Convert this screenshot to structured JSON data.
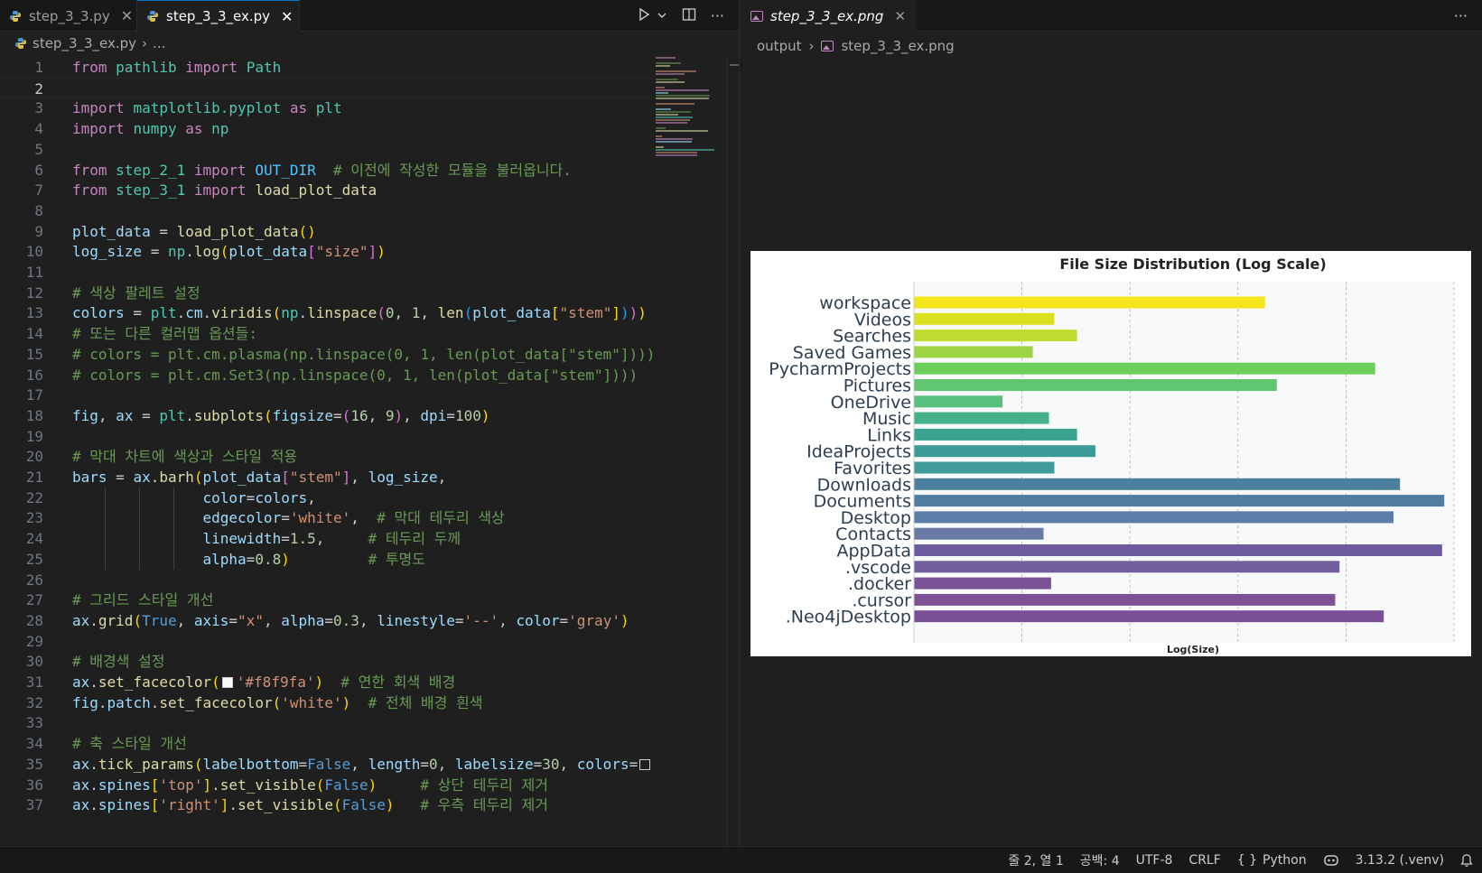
{
  "editor": {
    "tabs": [
      {
        "label": "step_3_3.py",
        "active": false
      },
      {
        "label": "step_3_3_ex.py",
        "active": true
      }
    ],
    "breadcrumb": {
      "file": "step_3_3_ex.py",
      "trail": "..."
    },
    "current_line": 2,
    "lines": [
      {
        "n": "1",
        "toks": [
          [
            "kw",
            "from"
          ],
          [
            "t",
            " "
          ],
          [
            "cls",
            "pathlib"
          ],
          [
            "t",
            " "
          ],
          [
            "kw",
            "import"
          ],
          [
            "t",
            " "
          ],
          [
            "cls",
            "Path"
          ]
        ]
      },
      {
        "n": "2",
        "toks": []
      },
      {
        "n": "3",
        "toks": [
          [
            "kw",
            "import"
          ],
          [
            "t",
            " "
          ],
          [
            "cls",
            "matplotlib.pyplot"
          ],
          [
            "t",
            " "
          ],
          [
            "kw",
            "as"
          ],
          [
            "t",
            " "
          ],
          [
            "cls",
            "plt"
          ]
        ]
      },
      {
        "n": "4",
        "toks": [
          [
            "kw",
            "import"
          ],
          [
            "t",
            " "
          ],
          [
            "cls",
            "numpy"
          ],
          [
            "t",
            " "
          ],
          [
            "kw",
            "as"
          ],
          [
            "t",
            " "
          ],
          [
            "cls",
            "np"
          ]
        ]
      },
      {
        "n": "5",
        "toks": []
      },
      {
        "n": "6",
        "toks": [
          [
            "kw",
            "from"
          ],
          [
            "t",
            " "
          ],
          [
            "cls",
            "step_2_1"
          ],
          [
            "t",
            " "
          ],
          [
            "kw",
            "import"
          ],
          [
            "t",
            " "
          ],
          [
            "const",
            "OUT_DIR"
          ],
          [
            "t",
            "  "
          ],
          [
            "cm",
            "# 이전에 작성한 모듈을 불러옵니다."
          ]
        ]
      },
      {
        "n": "7",
        "toks": [
          [
            "kw",
            "from"
          ],
          [
            "t",
            " "
          ],
          [
            "cls",
            "step_3_1"
          ],
          [
            "t",
            " "
          ],
          [
            "kw",
            "import"
          ],
          [
            "t",
            " "
          ],
          [
            "fn",
            "load_plot_data"
          ]
        ]
      },
      {
        "n": "8",
        "toks": []
      },
      {
        "n": "9",
        "toks": [
          [
            "var",
            "plot_data"
          ],
          [
            "t",
            " = "
          ],
          [
            "fn",
            "load_plot_data"
          ],
          [
            "br1",
            "()"
          ]
        ]
      },
      {
        "n": "10",
        "toks": [
          [
            "var",
            "log_size"
          ],
          [
            "t",
            " = "
          ],
          [
            "cls",
            "np"
          ],
          [
            "t",
            "."
          ],
          [
            "fn",
            "log"
          ],
          [
            "br1",
            "("
          ],
          [
            "var",
            "plot_data"
          ],
          [
            "br2",
            "["
          ],
          [
            "str",
            "\"size\""
          ],
          [
            "br2",
            "]"
          ],
          [
            "br1",
            ")"
          ]
        ]
      },
      {
        "n": "11",
        "toks": []
      },
      {
        "n": "12",
        "toks": [
          [
            "cm",
            "# 색상 팔레트 설정"
          ]
        ]
      },
      {
        "n": "13",
        "toks": [
          [
            "var",
            "colors"
          ],
          [
            "t",
            " = "
          ],
          [
            "cls",
            "plt"
          ],
          [
            "t",
            "."
          ],
          [
            "var",
            "cm"
          ],
          [
            "t",
            "."
          ],
          [
            "fn",
            "viridis"
          ],
          [
            "br1",
            "("
          ],
          [
            "cls",
            "np"
          ],
          [
            "t",
            "."
          ],
          [
            "fn",
            "linspace"
          ],
          [
            "br2",
            "("
          ],
          [
            "num",
            "0"
          ],
          [
            "t",
            ", "
          ],
          [
            "num",
            "1"
          ],
          [
            "t",
            ", "
          ],
          [
            "fn",
            "len"
          ],
          [
            "br3",
            "("
          ],
          [
            "var",
            "plot_data"
          ],
          [
            "br1",
            "["
          ],
          [
            "str",
            "\"stem\""
          ],
          [
            "br1",
            "]"
          ],
          [
            "br3",
            ")"
          ],
          [
            "br2",
            ")"
          ],
          [
            "br1",
            ")"
          ]
        ]
      },
      {
        "n": "14",
        "toks": [
          [
            "cm",
            "# 또는 다른 컬러맵 옵션들:"
          ]
        ]
      },
      {
        "n": "15",
        "toks": [
          [
            "cm",
            "# colors = plt.cm.plasma(np.linspace(0, 1, len(plot_data[\"stem\"])))"
          ]
        ]
      },
      {
        "n": "16",
        "toks": [
          [
            "cm",
            "# colors = plt.cm.Set3(np.linspace(0, 1, len(plot_data[\"stem\"])))"
          ]
        ]
      },
      {
        "n": "17",
        "toks": []
      },
      {
        "n": "18",
        "toks": [
          [
            "var",
            "fig"
          ],
          [
            "t",
            ", "
          ],
          [
            "var",
            "ax"
          ],
          [
            "t",
            " = "
          ],
          [
            "cls",
            "plt"
          ],
          [
            "t",
            "."
          ],
          [
            "fn",
            "subplots"
          ],
          [
            "br1",
            "("
          ],
          [
            "var",
            "figsize"
          ],
          [
            "t",
            "="
          ],
          [
            "br2",
            "("
          ],
          [
            "num",
            "16"
          ],
          [
            "t",
            ", "
          ],
          [
            "num",
            "9"
          ],
          [
            "br2",
            ")"
          ],
          [
            "t",
            ", "
          ],
          [
            "var",
            "dpi"
          ],
          [
            "t",
            "="
          ],
          [
            "num",
            "100"
          ],
          [
            "br1",
            ")"
          ]
        ]
      },
      {
        "n": "19",
        "toks": []
      },
      {
        "n": "20",
        "toks": [
          [
            "cm",
            "# 막대 차트에 색상과 스타일 적용"
          ]
        ]
      },
      {
        "n": "21",
        "toks": [
          [
            "var",
            "bars"
          ],
          [
            "t",
            " = "
          ],
          [
            "var",
            "ax"
          ],
          [
            "t",
            "."
          ],
          [
            "fn",
            "barh"
          ],
          [
            "br1",
            "("
          ],
          [
            "var",
            "plot_data"
          ],
          [
            "br2",
            "["
          ],
          [
            "str",
            "\"stem\""
          ],
          [
            "br2",
            "]"
          ],
          [
            "t",
            ", "
          ],
          [
            "var",
            "log_size"
          ],
          [
            "t",
            ","
          ]
        ]
      },
      {
        "n": "22",
        "guides": true,
        "toks": [
          [
            "t",
            "               "
          ],
          [
            "var",
            "color"
          ],
          [
            "t",
            "="
          ],
          [
            "var",
            "colors"
          ],
          [
            "t",
            ","
          ]
        ]
      },
      {
        "n": "23",
        "guides": true,
        "toks": [
          [
            "t",
            "               "
          ],
          [
            "var",
            "edgecolor"
          ],
          [
            "t",
            "="
          ],
          [
            "str",
            "'white'"
          ],
          [
            "t",
            ",  "
          ],
          [
            "cm",
            "# 막대 테두리 색상"
          ]
        ]
      },
      {
        "n": "24",
        "guides": true,
        "toks": [
          [
            "t",
            "               "
          ],
          [
            "var",
            "linewidth"
          ],
          [
            "t",
            "="
          ],
          [
            "num",
            "1.5"
          ],
          [
            "t",
            ",     "
          ],
          [
            "cm",
            "# 테두리 두께"
          ]
        ]
      },
      {
        "n": "25",
        "guides": true,
        "toks": [
          [
            "t",
            "               "
          ],
          [
            "var",
            "alpha"
          ],
          [
            "t",
            "="
          ],
          [
            "num",
            "0.8"
          ],
          [
            "br1",
            ")"
          ],
          [
            "t",
            "         "
          ],
          [
            "cm",
            "# 투명도"
          ]
        ]
      },
      {
        "n": "26",
        "toks": []
      },
      {
        "n": "27",
        "toks": [
          [
            "cm",
            "# 그리드 스타일 개선"
          ]
        ]
      },
      {
        "n": "28",
        "toks": [
          [
            "var",
            "ax"
          ],
          [
            "t",
            "."
          ],
          [
            "fn",
            "grid"
          ],
          [
            "br1",
            "("
          ],
          [
            "bool",
            "True"
          ],
          [
            "t",
            ", "
          ],
          [
            "var",
            "axis"
          ],
          [
            "t",
            "="
          ],
          [
            "str",
            "\"x\""
          ],
          [
            "t",
            ", "
          ],
          [
            "var",
            "alpha"
          ],
          [
            "t",
            "="
          ],
          [
            "num",
            "0.3"
          ],
          [
            "t",
            ", "
          ],
          [
            "var",
            "linestyle"
          ],
          [
            "t",
            "="
          ],
          [
            "str",
            "'--'"
          ],
          [
            "t",
            ", "
          ],
          [
            "var",
            "color"
          ],
          [
            "t",
            "="
          ],
          [
            "str",
            "'gray'"
          ],
          [
            "br1",
            ")"
          ]
        ]
      },
      {
        "n": "29",
        "toks": []
      },
      {
        "n": "30",
        "toks": [
          [
            "cm",
            "# 배경색 설정"
          ]
        ]
      },
      {
        "n": "31",
        "toks": [
          [
            "var",
            "ax"
          ],
          [
            "t",
            "."
          ],
          [
            "fn",
            "set_facecolor"
          ],
          [
            "br1",
            "("
          ],
          [
            "swatch",
            "#f8f9fa"
          ],
          [
            "str",
            "'#f8f9fa'"
          ],
          [
            "br1",
            ")"
          ],
          [
            "t",
            "  "
          ],
          [
            "cm",
            "# 연한 회색 배경"
          ]
        ]
      },
      {
        "n": "32",
        "toks": [
          [
            "var",
            "fig"
          ],
          [
            "t",
            "."
          ],
          [
            "var",
            "patch"
          ],
          [
            "t",
            "."
          ],
          [
            "fn",
            "set_facecolor"
          ],
          [
            "br1",
            "("
          ],
          [
            "str",
            "'white'"
          ],
          [
            "br1",
            ")"
          ],
          [
            "t",
            "  "
          ],
          [
            "cm",
            "# 전체 배경 흰색"
          ]
        ]
      },
      {
        "n": "33",
        "toks": []
      },
      {
        "n": "34",
        "toks": [
          [
            "cm",
            "# 축 스타일 개선"
          ]
        ]
      },
      {
        "n": "35",
        "toks": [
          [
            "var",
            "ax"
          ],
          [
            "t",
            "."
          ],
          [
            "fn",
            "tick_params"
          ],
          [
            "br1",
            "("
          ],
          [
            "var",
            "labelbottom"
          ],
          [
            "t",
            "="
          ],
          [
            "bool",
            "False"
          ],
          [
            "t",
            ", "
          ],
          [
            "var",
            "length"
          ],
          [
            "t",
            "="
          ],
          [
            "num",
            "0"
          ],
          [
            "t",
            ", "
          ],
          [
            "var",
            "labelsize"
          ],
          [
            "t",
            "="
          ],
          [
            "num",
            "30"
          ],
          [
            "t",
            ", "
          ],
          [
            "var",
            "colors"
          ],
          [
            "t",
            "="
          ],
          [
            "swatch",
            "#cccccc"
          ]
        ]
      },
      {
        "n": "36",
        "toks": [
          [
            "var",
            "ax"
          ],
          [
            "t",
            "."
          ],
          [
            "var",
            "spines"
          ],
          [
            "br1",
            "["
          ],
          [
            "str",
            "'top'"
          ],
          [
            "br1",
            "]"
          ],
          [
            "t",
            "."
          ],
          [
            "fn",
            "set_visible"
          ],
          [
            "br1",
            "("
          ],
          [
            "bool",
            "False"
          ],
          [
            "br1",
            ")"
          ],
          [
            "t",
            "     "
          ],
          [
            "cm",
            "# 상단 테두리 제거"
          ]
        ]
      },
      {
        "n": "37",
        "toks": [
          [
            "var",
            "ax"
          ],
          [
            "t",
            "."
          ],
          [
            "var",
            "spines"
          ],
          [
            "br1",
            "["
          ],
          [
            "str",
            "'right'"
          ],
          [
            "br1",
            "]"
          ],
          [
            "t",
            "."
          ],
          [
            "fn",
            "set_visible"
          ],
          [
            "br1",
            "("
          ],
          [
            "bool",
            "False"
          ],
          [
            "br1",
            ")"
          ],
          [
            "t",
            "   "
          ],
          [
            "cm",
            "# 우측 테두리 제거"
          ]
        ]
      }
    ]
  },
  "preview": {
    "tab_label": "step_3_3_ex.png",
    "breadcrumb": [
      "output",
      "step_3_3_ex.png"
    ]
  },
  "chart_data": {
    "type": "bar",
    "orientation": "horizontal",
    "title": "File Size Distribution (Log Scale)",
    "xlabel": "Log(Size)",
    "ylabel": "",
    "x_tick_labels_shown": false,
    "xlim": [
      0,
      5
    ],
    "grid": "x, dashed",
    "background": "#f8f9fa",
    "colormap": "viridis",
    "categories": [
      ".Neo4jDesktop",
      ".cursor",
      ".docker",
      ".vscode",
      "AppData",
      "Contacts",
      "Desktop",
      "Documents",
      "Downloads",
      "Favorites",
      "IdeaProjects",
      "Links",
      "Music",
      "OneDrive",
      "Pictures",
      "PycharmProjects",
      "Saved Games",
      "Searches",
      "Videos",
      "workspace"
    ],
    "values": [
      4.35,
      3.9,
      1.27,
      3.94,
      4.89,
      1.2,
      4.44,
      4.91,
      4.5,
      1.3,
      1.68,
      1.51,
      1.25,
      0.82,
      3.36,
      4.27,
      1.1,
      1.51,
      1.3,
      3.25
    ],
    "colors": [
      "#7a4f96",
      "#7e5096",
      "#7a5296",
      "#725e9c",
      "#6c5b9e",
      "#6a7aa6",
      "#5a7ea8",
      "#507ca2",
      "#4a809e",
      "#3f9a9a",
      "#3a9a96",
      "#3aa28e",
      "#46b088",
      "#56c07c",
      "#60c670",
      "#6ccf5c",
      "#9cd444",
      "#c0dc30",
      "#d8e020",
      "#f4e41c"
    ]
  },
  "statusbar": {
    "position": "줄 2, 열 1",
    "indent": "공백: 4",
    "encoding": "UTF-8",
    "eol": "CRLF",
    "language": "Python",
    "interpreter": "3.13.2 (.venv)"
  }
}
